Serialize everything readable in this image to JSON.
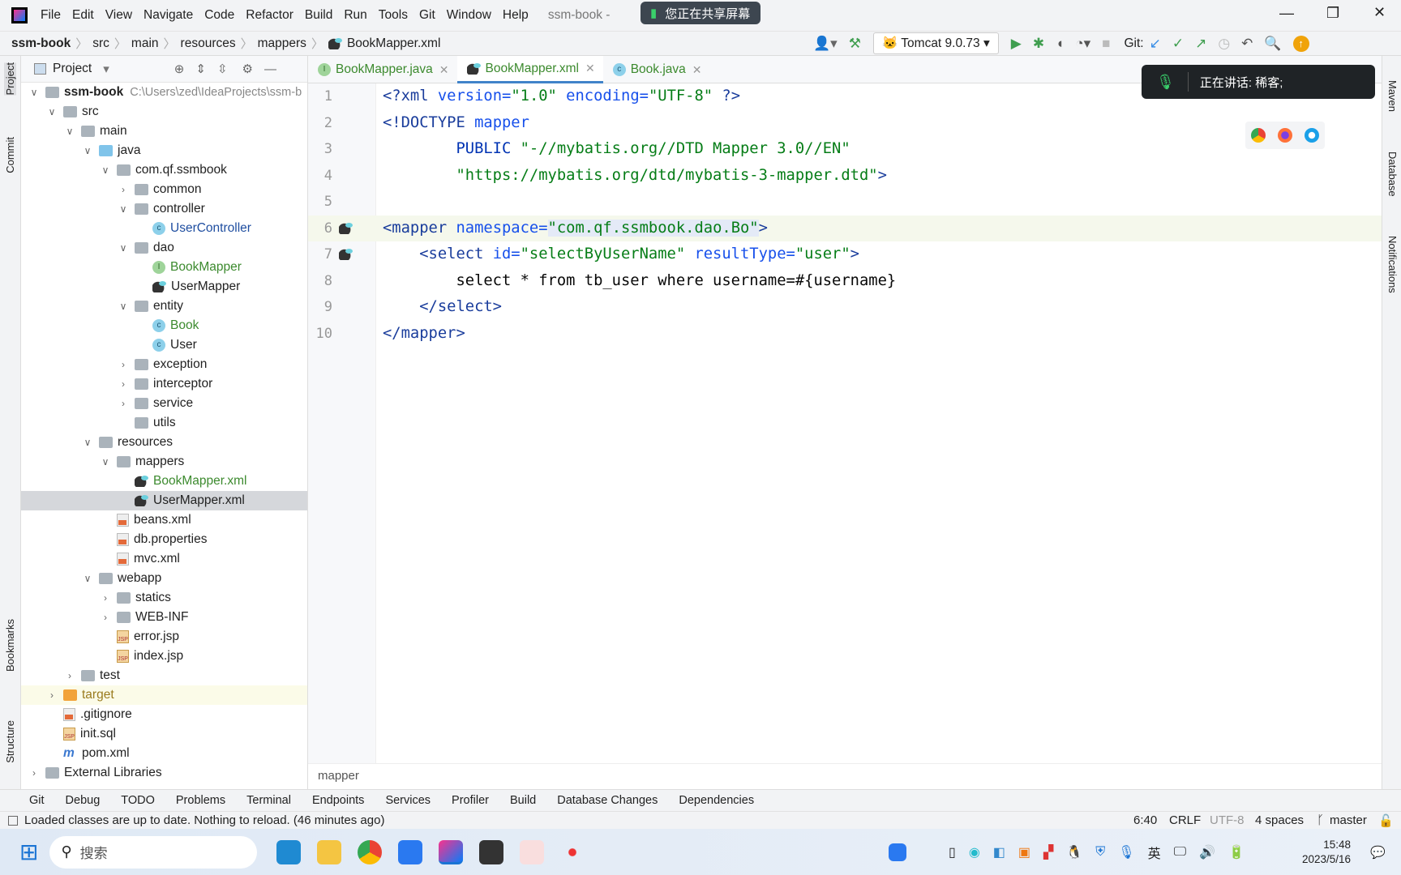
{
  "titlebar": {
    "menu": [
      "File",
      "Edit",
      "View",
      "Navigate",
      "Code",
      "Refactor",
      "Build",
      "Run",
      "Tools",
      "Git",
      "Window",
      "Help"
    ],
    "title": "ssm-book -"
  },
  "share_banner": "您正在共享屏幕",
  "speaking": "正在讲话:  稀客;",
  "breadcrumb": [
    "ssm-book",
    "src",
    "main",
    "resources",
    "mappers",
    "BookMapper.xml"
  ],
  "toolbar": {
    "run_config": "Tomcat 9.0.73",
    "git_label": "Git:",
    "colors": {
      "run": "#3f9e4f",
      "accent": "#4083c9"
    }
  },
  "project": {
    "title": "Project",
    "tree": [
      {
        "label": "ssm-book",
        "path": "C:\\Users\\zed\\IdeaProjects\\ssm-b",
        "depth": 0,
        "exp": "open",
        "icon": "module",
        "bold": true
      },
      {
        "label": "src",
        "depth": 1,
        "exp": "open",
        "icon": "folder"
      },
      {
        "label": "main",
        "depth": 2,
        "exp": "open",
        "icon": "folder"
      },
      {
        "label": "java",
        "depth": 3,
        "exp": "open",
        "icon": "folder-blue"
      },
      {
        "label": "com.qf.ssmbook",
        "depth": 4,
        "exp": "open",
        "icon": "package"
      },
      {
        "label": "common",
        "depth": 5,
        "exp": "closed",
        "icon": "package"
      },
      {
        "label": "controller",
        "depth": 5,
        "exp": "open",
        "icon": "package"
      },
      {
        "label": "UserController",
        "depth": 6,
        "icon": "class",
        "color": "#1f4ea0"
      },
      {
        "label": "dao",
        "depth": 5,
        "exp": "open",
        "icon": "package"
      },
      {
        "label": "BookMapper",
        "depth": 6,
        "icon": "interface",
        "color": "#3c8a2e"
      },
      {
        "label": "UserMapper",
        "depth": 6,
        "icon": "mybatis"
      },
      {
        "label": "entity",
        "depth": 5,
        "exp": "open",
        "icon": "package"
      },
      {
        "label": "Book",
        "depth": 6,
        "icon": "class",
        "color": "#3c8a2e"
      },
      {
        "label": "User",
        "depth": 6,
        "icon": "class"
      },
      {
        "label": "exception",
        "depth": 5,
        "exp": "closed",
        "icon": "package"
      },
      {
        "label": "interceptor",
        "depth": 5,
        "exp": "closed",
        "icon": "package"
      },
      {
        "label": "service",
        "depth": 5,
        "exp": "closed",
        "icon": "package"
      },
      {
        "label": "utils",
        "depth": 5,
        "icon": "package"
      },
      {
        "label": "resources",
        "depth": 3,
        "exp": "open",
        "icon": "folder"
      },
      {
        "label": "mappers",
        "depth": 4,
        "exp": "open",
        "icon": "folder"
      },
      {
        "label": "BookMapper.xml",
        "depth": 5,
        "icon": "mybatis",
        "color": "#3c8a2e"
      },
      {
        "label": "UserMapper.xml",
        "depth": 5,
        "icon": "mybatis",
        "selected": true
      },
      {
        "label": "beans.xml",
        "depth": 4,
        "icon": "xml"
      },
      {
        "label": "db.properties",
        "depth": 4,
        "icon": "xml"
      },
      {
        "label": "mvc.xml",
        "depth": 4,
        "icon": "xml"
      },
      {
        "label": "webapp",
        "depth": 3,
        "exp": "open",
        "icon": "folder"
      },
      {
        "label": "statics",
        "depth": 4,
        "exp": "closed",
        "icon": "folder"
      },
      {
        "label": "WEB-INF",
        "depth": 4,
        "exp": "closed",
        "icon": "folder"
      },
      {
        "label": "error.jsp",
        "depth": 4,
        "icon": "jsp"
      },
      {
        "label": "index.jsp",
        "depth": 4,
        "icon": "jsp"
      },
      {
        "label": "test",
        "depth": 2,
        "exp": "closed",
        "icon": "folder"
      },
      {
        "label": "target",
        "depth": 1,
        "exp": "closed",
        "icon": "folder-orange",
        "color": "#9a7b1e",
        "highlight": true
      },
      {
        "label": ".gitignore",
        "depth": 1,
        "icon": "xml"
      },
      {
        "label": "init.sql",
        "depth": 1,
        "icon": "jsp"
      },
      {
        "label": "pom.xml",
        "depth": 1,
        "icon": "maven"
      },
      {
        "label": "External Libraries",
        "depth": 0,
        "exp": "closed",
        "icon": "lib"
      }
    ]
  },
  "tabs": [
    {
      "label": "BookMapper.java",
      "icon": "interface"
    },
    {
      "label": "BookMapper.xml",
      "icon": "mybatis",
      "active": true
    },
    {
      "label": "Book.java",
      "icon": "class"
    }
  ],
  "editor": {
    "current_line": 6,
    "lines": [
      [
        [
          "<?",
          "t-tag"
        ],
        [
          "xml ",
          "t-tag"
        ],
        [
          "version=",
          "t-attr"
        ],
        [
          "\"1.0\"",
          "t-str"
        ],
        [
          " encoding=",
          "t-attr"
        ],
        [
          "\"UTF-8\"",
          "t-str"
        ],
        [
          " ?>",
          "t-tag"
        ]
      ],
      [
        [
          "<!DOCTYPE ",
          "t-tag"
        ],
        [
          "mapper",
          "t-attr"
        ]
      ],
      [
        [
          "        PUBLIC ",
          "t-kw"
        ],
        [
          "\"-//mybatis.org//DTD Mapper 3.0//EN\"",
          "t-str"
        ]
      ],
      [
        [
          "        \"https://mybatis.org/dtd/mybatis-3-mapper.dtd\"",
          "t-str"
        ],
        [
          ">",
          "t-tag"
        ]
      ],
      [],
      [
        [
          "<mapper ",
          "t-tag"
        ],
        [
          "namespace=",
          "t-attr"
        ],
        [
          "\"com.qf.ssmbook.dao.Bo\"",
          "t-str sel-ns"
        ],
        [
          ">",
          "t-tag"
        ]
      ],
      [
        [
          "    <select ",
          "t-tag"
        ],
        [
          "id=",
          "t-attr"
        ],
        [
          "\"selectByUserName\"",
          "t-str"
        ],
        [
          " resultType=",
          "t-attr"
        ],
        [
          "\"user\"",
          "t-str"
        ],
        [
          ">",
          "t-tag"
        ]
      ],
      [
        [
          "        select * from tb_user where username=#{username}",
          "t-txt"
        ]
      ],
      [
        [
          "    </select>",
          "t-tag"
        ]
      ],
      [
        [
          "</mapper>",
          "t-tag"
        ]
      ]
    ],
    "breadcrumb": "mapper"
  },
  "side_left": [
    "Project",
    "Commit",
    "Bookmarks",
    "Structure"
  ],
  "side_right": [
    "Maven",
    "Database",
    "Notifications"
  ],
  "tool_tabs": [
    "Git",
    "Debug",
    "TODO",
    "Problems",
    "Terminal",
    "Endpoints",
    "Services",
    "Profiler",
    "Build",
    "Database Changes",
    "Dependencies"
  ],
  "status": {
    "message": "Loaded classes are up to date. Nothing to reload. (46 minutes ago)",
    "position": "6:40",
    "line_sep": "CRLF",
    "encoding": "UTF-8",
    "indent": "4 spaces",
    "branch": "master"
  },
  "taskbar": {
    "search_placeholder": "搜索",
    "ime": "英",
    "time": "15:48",
    "date": "2023/5/16"
  }
}
